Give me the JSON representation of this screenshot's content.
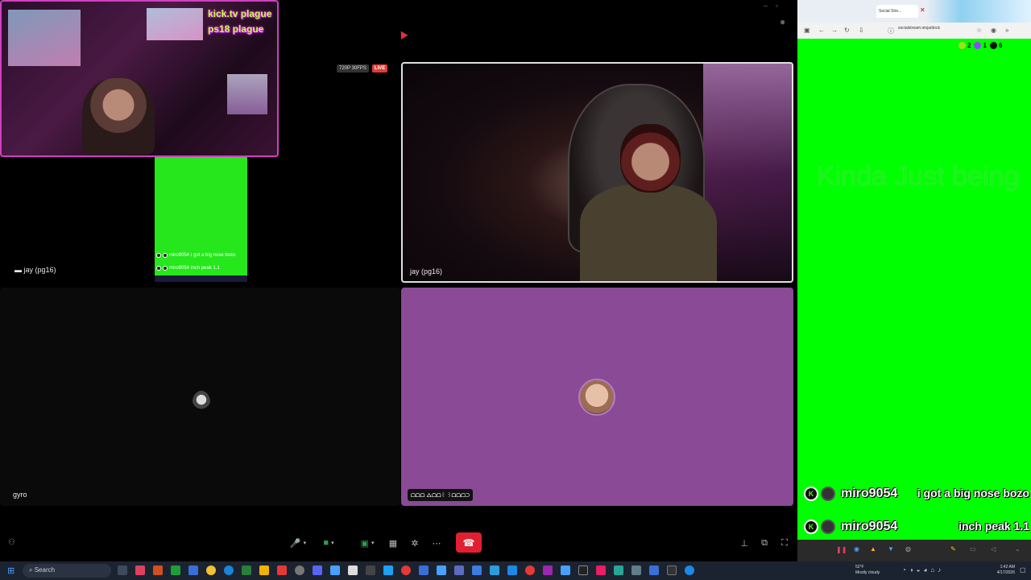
{
  "call": {
    "quality_badge": "720P 30FPS",
    "live_badge": "LIVE",
    "overlay_title": "kick.tv plague",
    "overlay_subtitle": "ps18 plague",
    "participants": [
      {
        "name": "jay (pg16)"
      },
      {
        "name": "jay (pg16)"
      },
      {
        "name": "gyro"
      },
      {
        "name": "ᗝᗝᗝ ᐃᗝᗝ꒰ ꒱ᗝᗝᗝᑐ"
      }
    ],
    "mini_chat": [
      {
        "user": "miro9054",
        "text": "i got a big nose bozo"
      },
      {
        "user": "miro9054",
        "text": "inch peak 1.1"
      }
    ],
    "controls": {
      "mic_icon": "microphone-icon",
      "camera_icon": "camera-icon",
      "screenshare_icon": "screenshare-icon",
      "layout_icon": "grid-icon",
      "effects_icon": "effects-icon",
      "more_icon": "more-icon",
      "hangup_icon": "phone-hangup-icon"
    }
  },
  "browser": {
    "tab_title": "Social Stre...",
    "url": "socialstream.ninja/dock",
    "stats": {
      "viewers": "2",
      "chat": "1",
      "kick": "6"
    },
    "ghost_text": "Kinda Just being",
    "chat": [
      {
        "user": "miro9054",
        "text": "i got a big nose bozo"
      },
      {
        "user": "miro9054",
        "text": "inch peak 1.1"
      }
    ]
  },
  "taskbar": {
    "search_placeholder": "Search",
    "weather_temp": "52°F",
    "weather_desc": "Mostly cloudy",
    "time": "1:42 AM",
    "date": "4/17/2026"
  },
  "colors": {
    "green_screen": "#00ff00",
    "purple_tile": "#8a4a96",
    "end_call": "#e02030",
    "kick_green": "#53fc18"
  }
}
